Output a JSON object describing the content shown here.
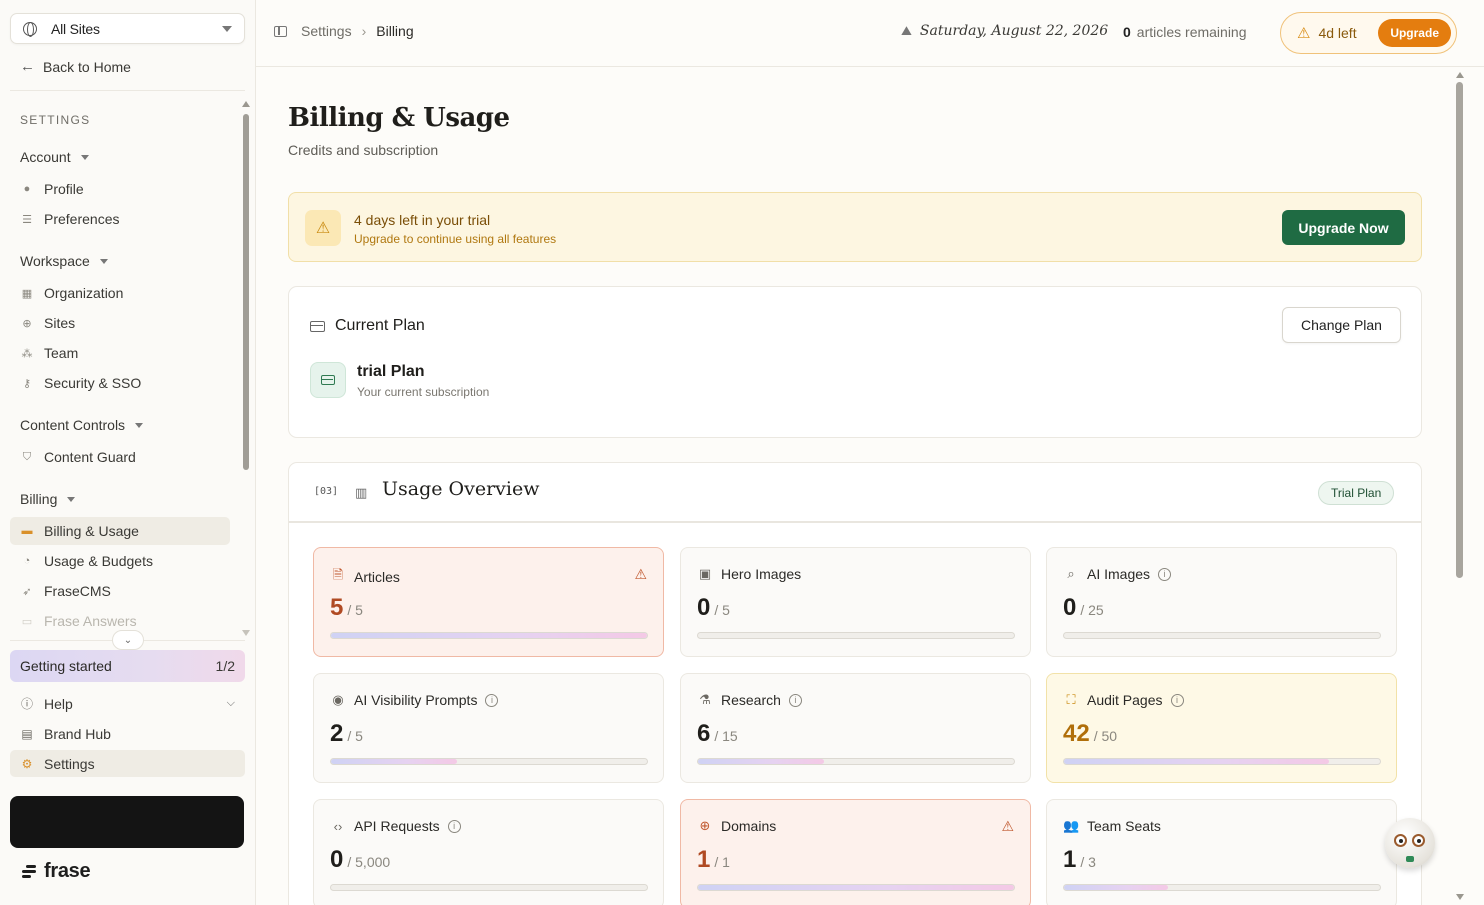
{
  "sidebar": {
    "site_selector": "All Sites",
    "back_link": "Back to Home",
    "section_caption": "SETTINGS",
    "groups": {
      "account": "Account",
      "workspace": "Workspace",
      "content_controls": "Content Controls",
      "billing": "Billing"
    },
    "items": {
      "profile": "Profile",
      "preferences": "Preferences",
      "organization": "Organization",
      "sites": "Sites",
      "team": "Team",
      "security": "Security & SSO",
      "content_guard": "Content Guard",
      "billing_usage": "Billing & Usage",
      "usage_budgets": "Usage & Budgets",
      "frasecms": "FraseCMS",
      "frase_answers": "Frase Answers"
    },
    "getting_started": {
      "label": "Getting started",
      "count": "1/2"
    },
    "bottom": {
      "help": "Help",
      "brand_hub": "Brand Hub",
      "settings": "Settings"
    },
    "brand": "frase"
  },
  "header": {
    "breadcrumb": {
      "parent": "Settings",
      "current": "Billing"
    },
    "date": "Saturday, August 22, 2026",
    "articles_remaining": {
      "count": "0",
      "label": "articles remaining"
    },
    "trial": {
      "days_left": "4d left",
      "upgrade": "Upgrade"
    }
  },
  "page": {
    "title": "Billing & Usage",
    "subtitle": "Credits and subscription"
  },
  "trial_banner": {
    "title": "4 days left in your trial",
    "subtitle": "Upgrade to continue using all features",
    "button": "Upgrade Now"
  },
  "current_plan": {
    "heading": "Current Plan",
    "change_button": "Change Plan",
    "plan_name": "trial Plan",
    "plan_desc": "Your current subscription"
  },
  "usage": {
    "index": "[03]",
    "title": "Usage Overview",
    "badge": "Trial Plan",
    "tiles": [
      {
        "name": "Articles",
        "used": "5",
        "limit": "/ 5",
        "fraction": 1.0,
        "state": "alert",
        "icon": "doc-icon",
        "info": false
      },
      {
        "name": "Hero Images",
        "used": "0",
        "limit": "/ 5",
        "fraction": 0.0,
        "state": "normal",
        "icon": "image-icon",
        "info": false
      },
      {
        "name": "AI Images",
        "used": "0",
        "limit": "/ 25",
        "fraction": 0.0,
        "state": "normal",
        "icon": "search-icon",
        "info": true
      },
      {
        "name": "AI Visibility Prompts",
        "used": "2",
        "limit": "/ 5",
        "fraction": 0.4,
        "state": "normal",
        "icon": "eye-icon",
        "info": true
      },
      {
        "name": "Research",
        "used": "6",
        "limit": "/ 15",
        "fraction": 0.4,
        "state": "normal",
        "icon": "flask-icon",
        "info": true
      },
      {
        "name": "Audit Pages",
        "used": "42",
        "limit": "/ 50",
        "fraction": 0.84,
        "state": "warn",
        "icon": "scan-icon",
        "info": true
      },
      {
        "name": "API Requests",
        "used": "0",
        "limit": "/ 5,000",
        "fraction": 0.0,
        "state": "normal",
        "icon": "code-icon",
        "info": true
      },
      {
        "name": "Domains",
        "used": "1",
        "limit": "/ 1",
        "fraction": 1.0,
        "state": "alert",
        "icon": "globe-icon",
        "info": false
      },
      {
        "name": "Team Seats",
        "used": "1",
        "limit": "/ 3",
        "fraction": 0.33,
        "state": "normal",
        "icon": "users-icon",
        "info": false
      }
    ]
  },
  "icons": {
    "doc-icon": "🗎",
    "image-icon": "▣",
    "search-icon": "⌕",
    "eye-icon": "◉",
    "flask-icon": "⚗",
    "scan-icon": "⛶",
    "code-icon": "‹›",
    "globe-icon": "⊕",
    "users-icon": "👥"
  }
}
